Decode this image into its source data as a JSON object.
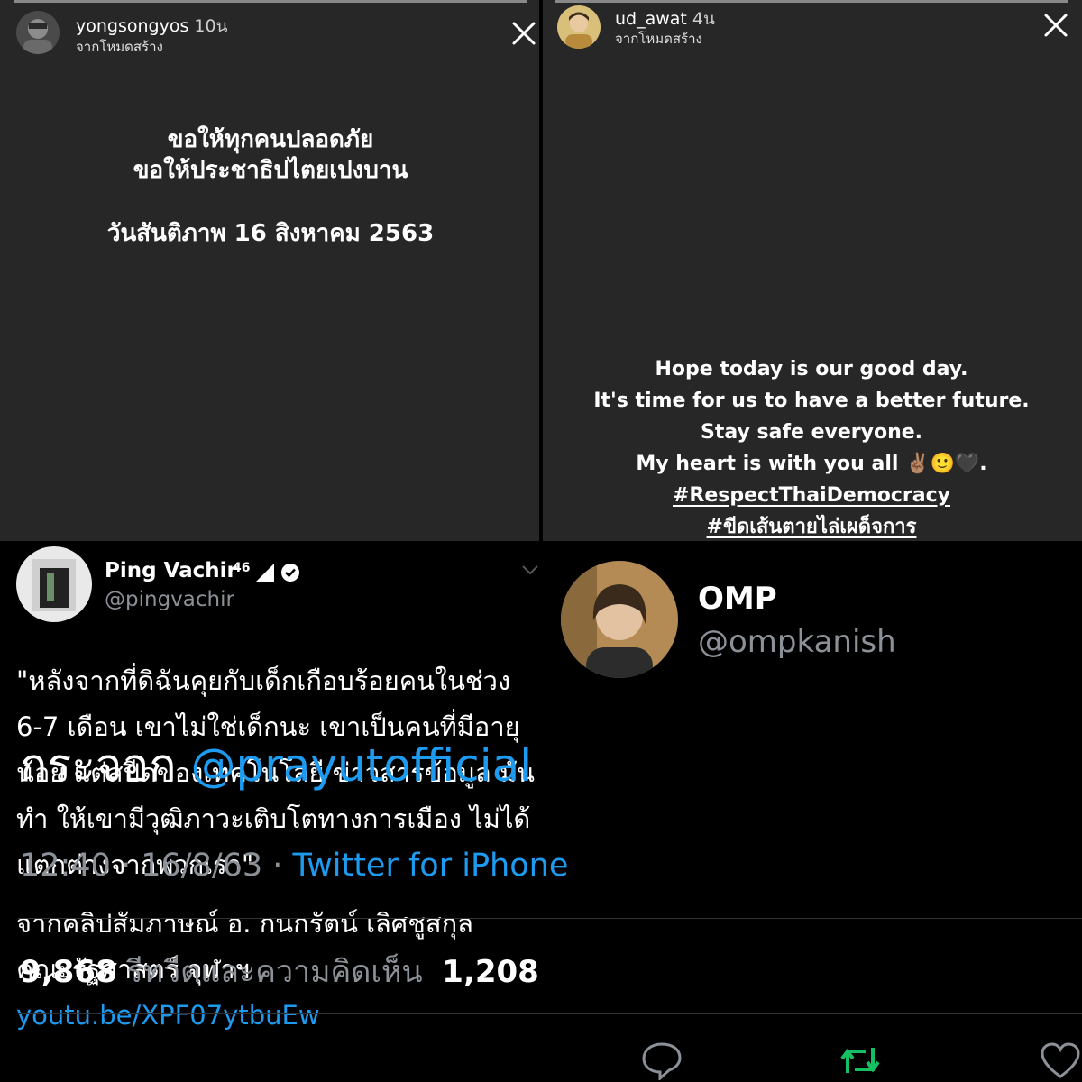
{
  "story_left": {
    "username": "yongsongyos",
    "time": "10น",
    "source": "จากโหมดสร้าง",
    "lines": [
      "ขอให้ทุกคนปลอดภัย",
      "ขอให้ประชาธิปไตยเปงบาน",
      "วันสันติภาพ 16 สิงหาคม 2563"
    ]
  },
  "story_right": {
    "username": "ud_awat",
    "time": "4น",
    "source": "จากโหมดสร้าง",
    "lines": [
      "Hope today is our good day.",
      "It's time for us to have a better future.",
      "Stay safe everyone.",
      "My heart is with you all ✌🏽🙂🖤."
    ],
    "hashtags": [
      "#RespectThaiDemocracy",
      "#ขีดเส้นตายไล่เผด็จการ"
    ]
  },
  "tweet_left": {
    "name": "Ping Vachir",
    "handle": "@pingvachir",
    "status": "46",
    "quote": "\"หลังจากที่ดิฉันคุยกับเด็กเกือบร้อยคนในช่วง 6-7 เดือน เขาไม่ใช่เด็กนะ เขาเป็นคนที่มีอายุน้อย แต่สปีดของเทคโนโลยี ข่าวสารข้อมูล มันทำ ให้เขามีวุฒิภาวะเติบโตทางการเมือง ไม่ได้แตกต่างจากพวกเรา\"",
    "source_text": "จากคลิปสัมภาษณ์ อ. กนกรัตน์ เลิศชูสกุล คณะรัฐศาสตร์ จุฬาฯ ",
    "link": "youtu.be/XPF07ytbuEw"
  },
  "tweet_right": {
    "name": "OMP",
    "handle": "@ompkanish",
    "text": "กระจอก ",
    "mention": "@prayutofficial",
    "timestamp": "12:40 · 16/8/63 · ",
    "client": "Twitter for iPhone",
    "retweet_count": "9,868",
    "retweet_label": "รีทวีตและความคิดเห็น",
    "like_count": "1,208"
  },
  "colors": {
    "story_bg": "#272727",
    "tweet_bg": "#000000",
    "link": "#1d9bf0",
    "muted": "#8b9197",
    "retweet_active": "#17bf63"
  },
  "icons": [
    "close-icon",
    "verified-icon",
    "signal-icon",
    "chevron-down-icon",
    "reply-icon",
    "retweet-icon",
    "like-icon"
  ]
}
